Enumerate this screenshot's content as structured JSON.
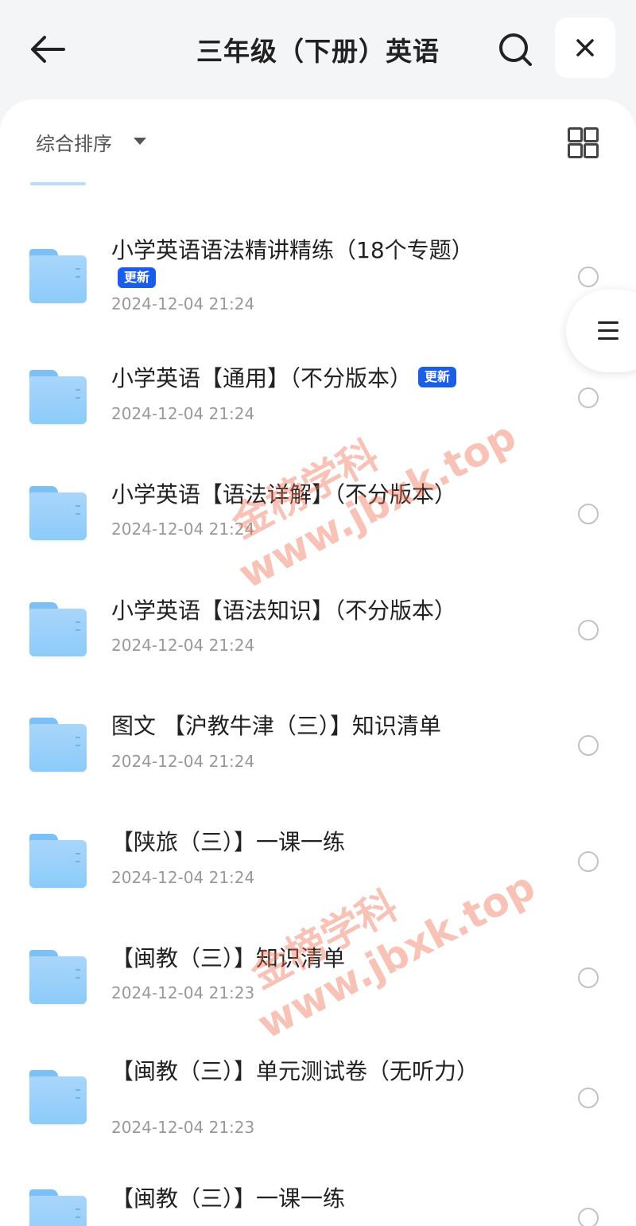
{
  "header": {
    "title": "三年级（下册）英语",
    "back_icon": "arrow-left-icon",
    "search_icon": "search-icon",
    "close_icon": "close-icon"
  },
  "toolbar": {
    "sort_label": "综合排序",
    "view_toggle_icon": "grid-view-icon"
  },
  "side_menu_icon": "menu-icon",
  "files": [
    {
      "name": "小学英语语法精讲精练（18个专题）",
      "badge": "更新",
      "date": "2024-12-04 21:24"
    },
    {
      "name": "小学英语【通用】（不分版本）",
      "badge": "更新",
      "date": "2024-12-04 21:24"
    },
    {
      "name": "小学英语【语法详解】（不分版本）",
      "badge": "",
      "date": "2024-12-04 21:24"
    },
    {
      "name": "小学英语【语法知识】（不分版本）",
      "badge": "",
      "date": "2024-12-04 21:24"
    },
    {
      "name": "图文 【沪教牛津（三）】知识清单",
      "badge": "",
      "date": "2024-12-04 21:24"
    },
    {
      "name": "【陕旅（三）】一课一练",
      "badge": "",
      "date": "2024-12-04 21:24"
    },
    {
      "name": "【闽教（三）】知识清单",
      "badge": "",
      "date": "2024-12-04 21:23"
    },
    {
      "name": "【闽教（三）】单元测试卷（无听力）",
      "badge": "",
      "date": "2024-12-04 21:23"
    },
    {
      "name": "【闽教（三）】一课一练",
      "badge": "",
      "date": ""
    }
  ],
  "watermarks": [
    {
      "line1": "金榜学科",
      "line2": "www.jbxk.top"
    },
    {
      "line1": "金榜学科",
      "line2": "www.jbxk.top"
    }
  ]
}
